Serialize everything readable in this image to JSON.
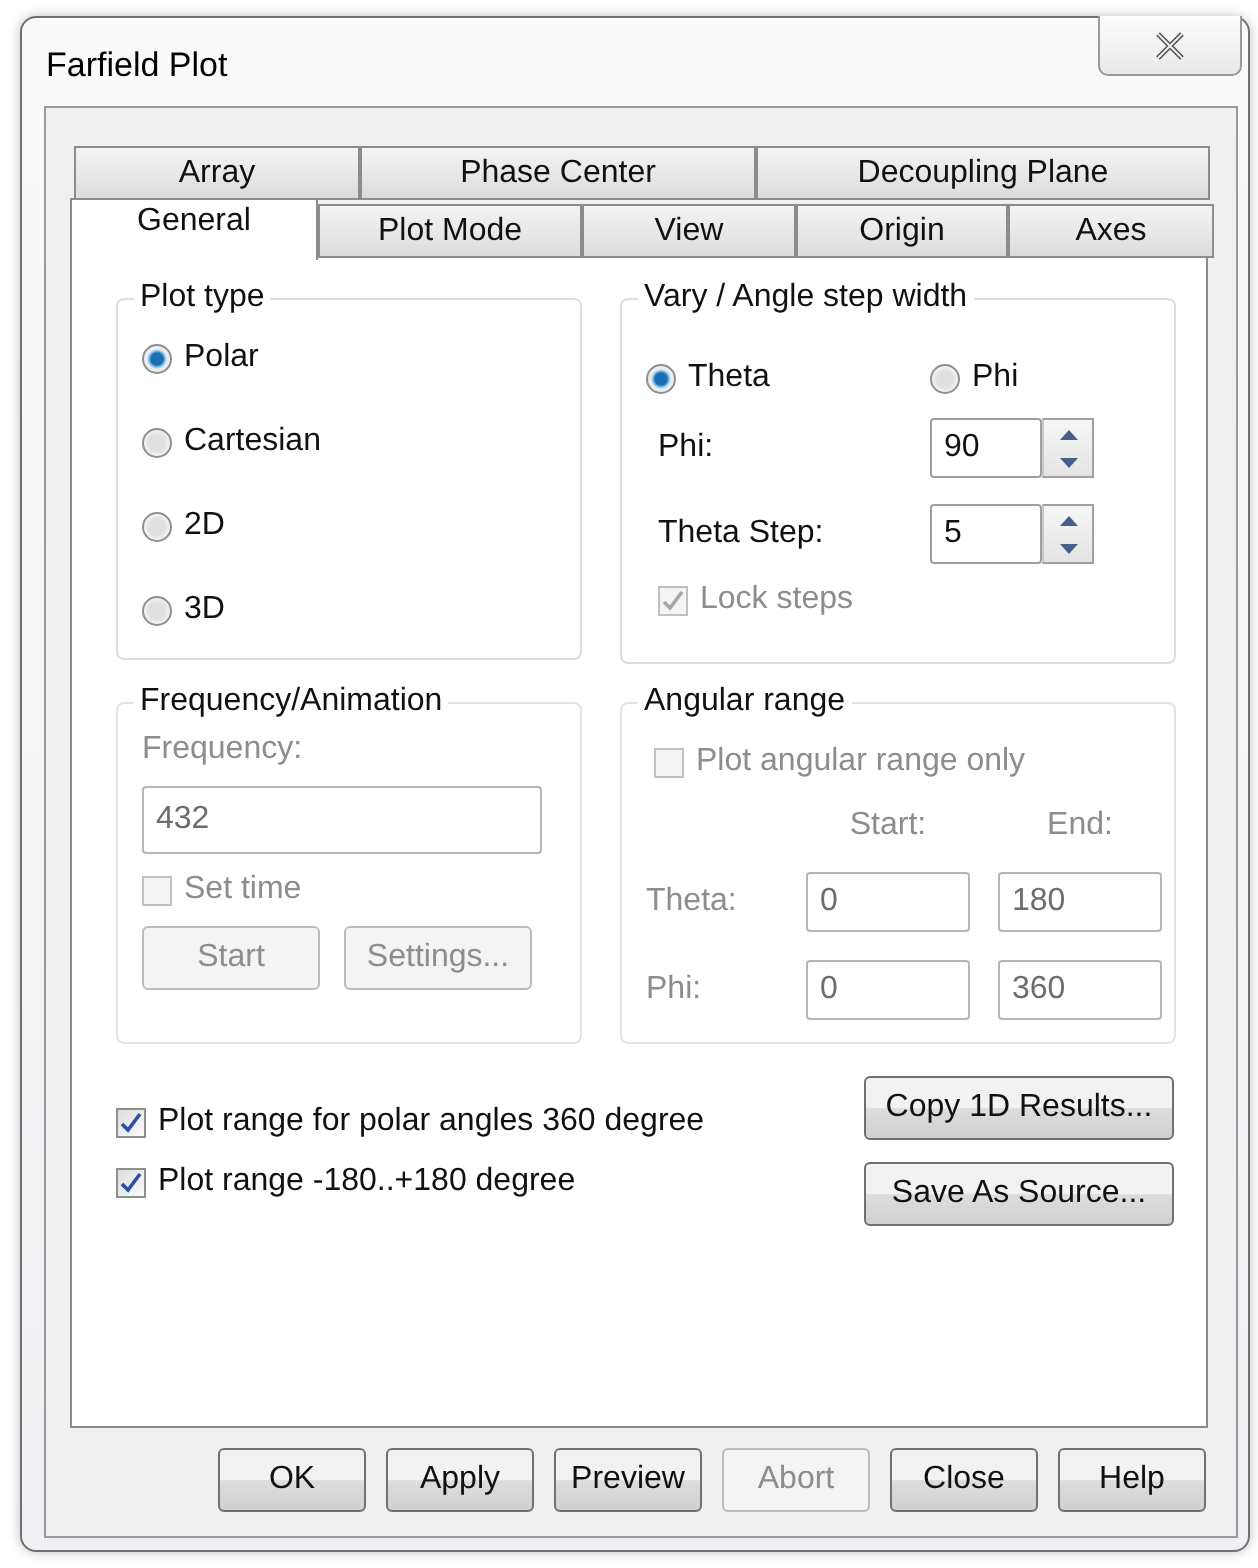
{
  "window": {
    "title": "Farfield Plot"
  },
  "tab_rows": [
    {
      "tabs": [
        {
          "label": "Array",
          "selected": false
        },
        {
          "label": "Phase Center",
          "selected": false
        },
        {
          "label": "Decoupling Plane",
          "selected": false
        }
      ]
    },
    {
      "tabs": [
        {
          "label": "General",
          "selected": true
        },
        {
          "label": "Plot Mode",
          "selected": false
        },
        {
          "label": "View",
          "selected": false
        },
        {
          "label": "Origin",
          "selected": false
        },
        {
          "label": "Axes",
          "selected": false
        }
      ]
    }
  ],
  "plot_type": {
    "title": "Plot type",
    "options": [
      {
        "label": "Polar",
        "selected": true
      },
      {
        "label": "Cartesian",
        "selected": false
      },
      {
        "label": "2D",
        "selected": false
      },
      {
        "label": "3D",
        "selected": false
      }
    ]
  },
  "vary": {
    "title": "Vary / Angle step width",
    "options": [
      {
        "label": "Theta",
        "selected": true
      },
      {
        "label": "Phi",
        "selected": false
      }
    ],
    "fields": [
      {
        "label": "Phi:",
        "value": "90"
      },
      {
        "label": "Theta Step:",
        "value": "5"
      }
    ],
    "lock_steps": {
      "label": "Lock steps",
      "checked": true,
      "disabled": true
    }
  },
  "frequency": {
    "title": "Frequency/Animation",
    "disabled": true,
    "label": "Frequency:",
    "value": "432",
    "set_time": {
      "label": "Set time",
      "checked": false
    },
    "buttons": [
      "Start",
      "Settings..."
    ]
  },
  "angular_range": {
    "title": "Angular range",
    "disabled": true,
    "plot_only": {
      "label": "Plot angular range only",
      "checked": false
    },
    "columns": [
      "Start:",
      "End:"
    ],
    "rows": [
      {
        "label": "Theta:",
        "start": "0",
        "end": "180"
      },
      {
        "label": "Phi:",
        "start": "0",
        "end": "360"
      }
    ]
  },
  "options": [
    {
      "label": "Plot range for polar angles 360 degree",
      "checked": true
    },
    {
      "label": "Plot range -180..+180 degree",
      "checked": true
    }
  ],
  "side_buttons": [
    "Copy 1D Results...",
    "Save As Source..."
  ],
  "footer_buttons": [
    {
      "label": "OK",
      "disabled": false
    },
    {
      "label": "Apply",
      "disabled": false
    },
    {
      "label": "Preview",
      "disabled": false
    },
    {
      "label": "Abort",
      "disabled": true
    },
    {
      "label": "Close",
      "disabled": false
    },
    {
      "label": "Help",
      "disabled": false
    }
  ]
}
